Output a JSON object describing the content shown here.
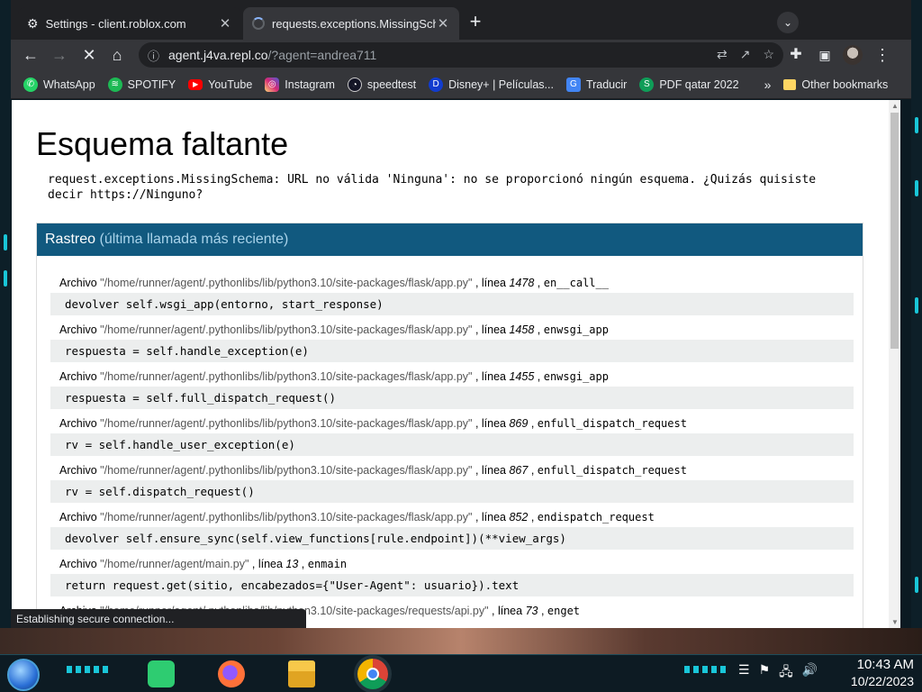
{
  "browser": {
    "tabs": [
      {
        "title": "Settings - client.roblox.com",
        "active": false
      },
      {
        "title": "requests.exceptions.MissingSchema",
        "active": true
      }
    ],
    "address": {
      "host": "agent.j4va.repl.co",
      "path": "/?agent=andrea711"
    },
    "bookmarks": [
      {
        "label": "WhatsApp",
        "icon": "whatsapp-icon",
        "color": "#25d366"
      },
      {
        "label": "SPOTIFY",
        "icon": "spotify-icon",
        "color": "#1db954"
      },
      {
        "label": "YouTube",
        "icon": "youtube-icon",
        "color": "#ff0000"
      },
      {
        "label": "Instagram",
        "icon": "instagram-icon",
        "color": "#d6249f"
      },
      {
        "label": "speedtest",
        "icon": "speedtest-icon",
        "color": "#141526"
      },
      {
        "label": "Disney+ | Películas...",
        "icon": "disney-icon",
        "color": "#113ccf"
      },
      {
        "label": "Traducir",
        "icon": "translate-icon",
        "color": "#4285f4"
      },
      {
        "label": "PDF qatar 2022",
        "icon": "pdf-icon",
        "color": "#0f9d58"
      }
    ],
    "other_bookmarks": "Other bookmarks",
    "status_text": "Establishing secure connection..."
  },
  "page": {
    "title": "Esquema faltante",
    "error_message": "request.exceptions.MissingSchema: URL no válida 'Ninguna': no se proporcionó ningún esquema. ¿Quizás quisiste decir https://Ninguno?",
    "traceback_title": "Rastreo",
    "traceback_subtitle": "(última llamada más reciente)",
    "frames": [
      {
        "file_label": "Archivo",
        "path": "\"/home/runner/agent/.pythonlibs/lib/python3.10/site-packages/flask/app.py\"",
        "line_label": "línea",
        "line": "1478",
        "func": "en__call__",
        "code": "devolver self.wsgi_app(entorno, start_response)"
      },
      {
        "file_label": "Archivo",
        "path": "\"/home/runner/agent/.pythonlibs/lib/python3.10/site-packages/flask/app.py\"",
        "line_label": "línea",
        "line": "1458",
        "func": "enwsgi_app",
        "code": "respuesta = self.handle_exception(e)"
      },
      {
        "file_label": "Archivo",
        "path": "\"/home/runner/agent/.pythonlibs/lib/python3.10/site-packages/flask/app.py\"",
        "line_label": "línea",
        "line": "1455",
        "func": "enwsgi_app",
        "code": "respuesta = self.full_dispatch_request()"
      },
      {
        "file_label": "Archivo",
        "path": "\"/home/runner/agent/.pythonlibs/lib/python3.10/site-packages/flask/app.py\"",
        "line_label": "línea",
        "line": "869",
        "func": "enfull_dispatch_request",
        "code": "rv = self.handle_user_exception(e)"
      },
      {
        "file_label": "Archivo",
        "path": "\"/home/runner/agent/.pythonlibs/lib/python3.10/site-packages/flask/app.py\"",
        "line_label": "línea",
        "line": "867",
        "func": "enfull_dispatch_request",
        "code": "rv = self.dispatch_request()"
      },
      {
        "file_label": "Archivo",
        "path": "\"/home/runner/agent/.pythonlibs/lib/python3.10/site-packages/flask/app.py\"",
        "line_label": "línea",
        "line": "852",
        "func": "endispatch_request",
        "code": "devolver self.ensure_sync(self.view_functions[rule.endpoint])(**view_args)"
      },
      {
        "file_label": "Archivo",
        "path": "\"/home/runner/agent/main.py\"",
        "line_label": "línea",
        "line": "13",
        "func": "enmain",
        "code": "return request.get(sitio, encabezados={\"User-Agent\": usuario}).text"
      },
      {
        "file_label": "Archivo",
        "path": "\"/home/runner/agent/.pythonlibs/lib/python3.10/site-packages/requests/api.py\"",
        "line_label": "línea",
        "line": "73",
        "func": "enget",
        "code": ""
      }
    ]
  },
  "taskbar": {
    "time": "10:43 AM",
    "date": "10/22/2023",
    "apps": [
      "start-orb",
      "notes-app-icon",
      "firefox-icon",
      "file-explorer-icon",
      "chrome-icon"
    ]
  }
}
